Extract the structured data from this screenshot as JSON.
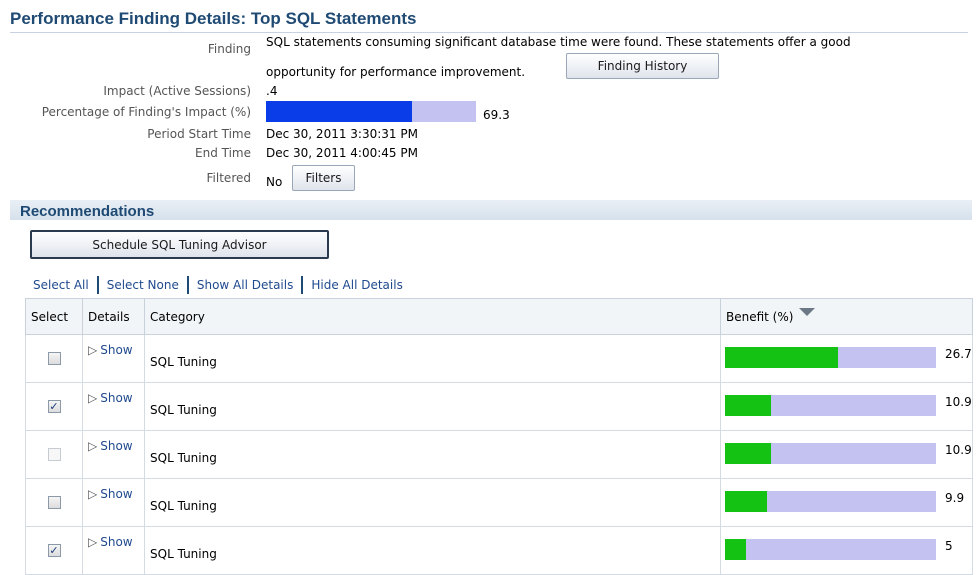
{
  "header": {
    "title": "Performance Finding Details: Top SQL Statements"
  },
  "details": {
    "finding_label": "Finding",
    "finding_line1": "SQL statements consuming significant database time were found. These statements offer a good",
    "finding_line2": "opportunity for performance improvement.",
    "finding_history_button": "Finding History",
    "impact_label": "Impact (Active Sessions)",
    "impact_value": ".4",
    "percentage_label": "Percentage of Finding's Impact (%)",
    "percentage_value": "69.3",
    "percentage_fraction": 0.693,
    "period_start_label": "Period Start Time",
    "period_start_value": "Dec 30, 2011 3:30:31 PM",
    "end_time_label": "End Time",
    "end_time_value": "Dec 30, 2011 4:00:45 PM",
    "filtered_label": "Filtered",
    "filtered_value": "No",
    "filters_button": "Filters",
    "colors": {
      "impact_fill": "#0a3de8",
      "impact_track": "#c3c2f1"
    }
  },
  "recommendations": {
    "title": "Recommendations",
    "schedule_button": "Schedule SQL Tuning Advisor",
    "links": {
      "select_all": "Select All",
      "select_none": "Select None",
      "show_all": "Show All Details",
      "hide_all": "Hide All Details"
    },
    "columns": {
      "select": "Select",
      "details": "Details",
      "category": "Category",
      "benefit": "Benefit (%)"
    },
    "benefit_max": 50,
    "colors": {
      "benefit_fill": "#13c212",
      "benefit_track": "#c3c2f1"
    },
    "rows": [
      {
        "checked": false,
        "disabled": false,
        "details": "Show",
        "category": "SQL Tuning",
        "benefit": "26.7",
        "benefit_num": 26.7
      },
      {
        "checked": true,
        "disabled": false,
        "details": "Show",
        "category": "SQL Tuning",
        "benefit": "10.9",
        "benefit_num": 10.9
      },
      {
        "checked": false,
        "disabled": true,
        "details": "Show",
        "category": "SQL Tuning",
        "benefit": "10.9",
        "benefit_num": 10.9
      },
      {
        "checked": false,
        "disabled": false,
        "details": "Show",
        "category": "SQL Tuning",
        "benefit": "9.9",
        "benefit_num": 9.9
      },
      {
        "checked": true,
        "disabled": false,
        "details": "Show",
        "category": "SQL Tuning",
        "benefit": "5",
        "benefit_num": 5
      }
    ]
  }
}
